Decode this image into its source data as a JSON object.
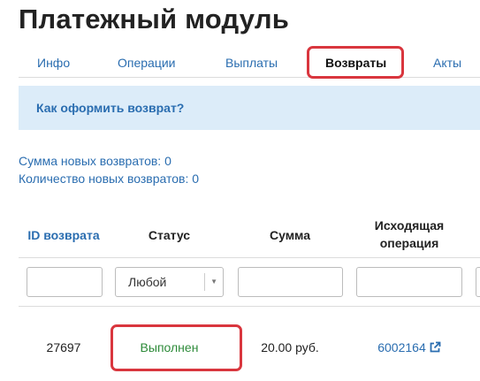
{
  "page": {
    "title": "Платежный модуль"
  },
  "tabs": [
    {
      "label": "Инфо",
      "active": false
    },
    {
      "label": "Операции",
      "active": false
    },
    {
      "label": "Выплаты",
      "active": false
    },
    {
      "label": "Возвраты",
      "active": true
    },
    {
      "label": "Акты",
      "active": false
    }
  ],
  "help": {
    "link_text": "Как оформить возврат?"
  },
  "stats": {
    "new_refunds_sum": "Сумма новых возвратов: 0",
    "new_refunds_count": "Количество новых возвратов: 0"
  },
  "table": {
    "headers": {
      "id": "ID возврата",
      "status": "Статус",
      "amount": "Сумма",
      "operation_line1": "Исходящая",
      "operation_line2": "операция"
    },
    "filters": {
      "status_selected": "Любой"
    },
    "rows": [
      {
        "id": "27697",
        "status": "Выполнен",
        "amount": "20.00 руб.",
        "operation": "6002164"
      }
    ]
  },
  "colors": {
    "accent": "#2a6db0",
    "highlight": "#d9363e",
    "success": "#2e8b3a",
    "help_bg": "#dcecf9"
  }
}
